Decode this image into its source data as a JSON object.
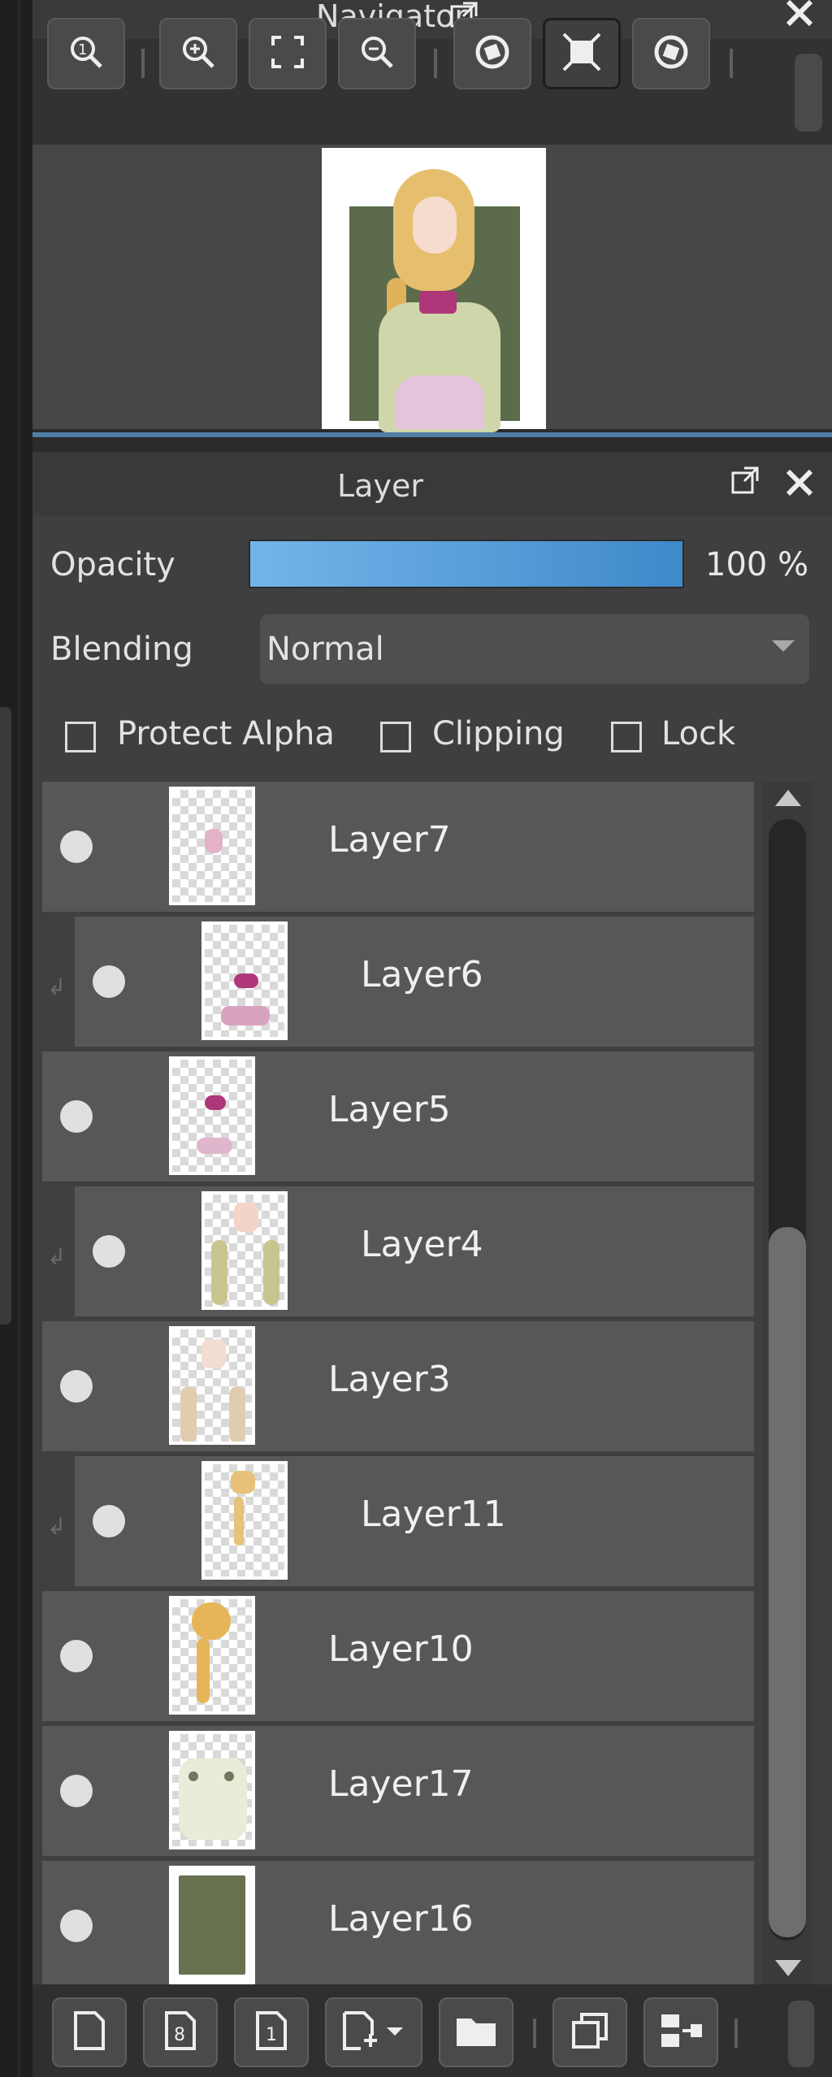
{
  "navigator": {
    "title": "Navigator",
    "toolbar": [
      {
        "name": "zoom-actual-icon"
      },
      {
        "name": "zoom-in-icon"
      },
      {
        "name": "fit-screen-icon"
      },
      {
        "name": "zoom-out-icon"
      },
      {
        "name": "rotate-left-icon"
      },
      {
        "name": "flip-icon"
      },
      {
        "name": "rotate-right-icon"
      }
    ]
  },
  "layer_panel": {
    "title": "Layer",
    "opacity_label": "Opacity",
    "opacity_value": "100 %",
    "blending_label": "Blending",
    "blending_value": "Normal",
    "protect_alpha_label": "Protect Alpha",
    "clipping_label": "Clipping",
    "lock_label": "Lock",
    "layers": [
      {
        "name": "Layer7",
        "clipped": false
      },
      {
        "name": "Layer6",
        "clipped": true
      },
      {
        "name": "Layer5",
        "clipped": false
      },
      {
        "name": "Layer4",
        "clipped": true
      },
      {
        "name": "Layer3",
        "clipped": false
      },
      {
        "name": "Layer11",
        "clipped": true
      },
      {
        "name": "Layer10",
        "clipped": false
      },
      {
        "name": "Layer17",
        "clipped": false
      },
      {
        "name": "Layer16",
        "clipped": false
      }
    ]
  },
  "colors": {
    "accent": "#4a93d2",
    "panel_bg": "#3f3f3f",
    "layer_row": "#575757"
  }
}
